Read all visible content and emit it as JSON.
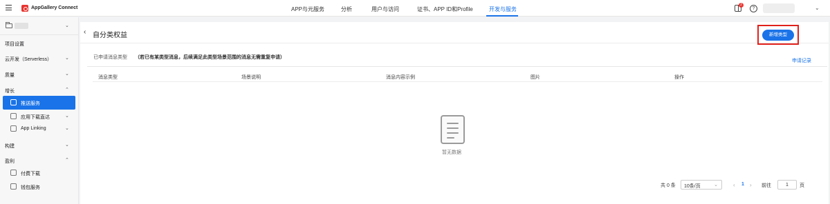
{
  "topbar": {
    "brand": "AppGallery Connect",
    "tabs": [
      "APP与元服务",
      "分析",
      "用户与访问",
      "证书、APP ID和Profile",
      "开发与服务"
    ],
    "active_tab": "开发与服务",
    "notification_count": "2",
    "help_glyph": "?"
  },
  "sidebar": {
    "items": [
      {
        "label": "项目设置"
      },
      {
        "label": "云开发（Serverless）"
      },
      {
        "label": "质量"
      },
      {
        "label": "增长"
      },
      {
        "label": "推送服务"
      },
      {
        "label": "应用下载直达"
      },
      {
        "label": "App Linking"
      },
      {
        "label": "构建"
      },
      {
        "label": "盈利"
      },
      {
        "label": "付费下载"
      },
      {
        "label": "钱包服务"
      }
    ]
  },
  "main": {
    "title": "自分类权益",
    "new_button": "新增类型",
    "applied_label": "已申请消息类型",
    "applied_note": "（若已有某类型消息，后续满足此类型场景范围的消息无需重复申请）",
    "apply_record_link": "申请记录",
    "columns": [
      "消息类型",
      "场景说明",
      "消息内容示例",
      "图片",
      "操作"
    ],
    "empty_text": "暂无数据"
  },
  "pagination": {
    "total": "共 0 条",
    "page_size": "10条/页",
    "current_page": "1",
    "goto_label": "前往",
    "goto_value": "1",
    "page_suffix": "页"
  },
  "colors": {
    "accent": "#1a73e8",
    "highlight": "#e0201b",
    "brand_red": "#e8342f"
  }
}
